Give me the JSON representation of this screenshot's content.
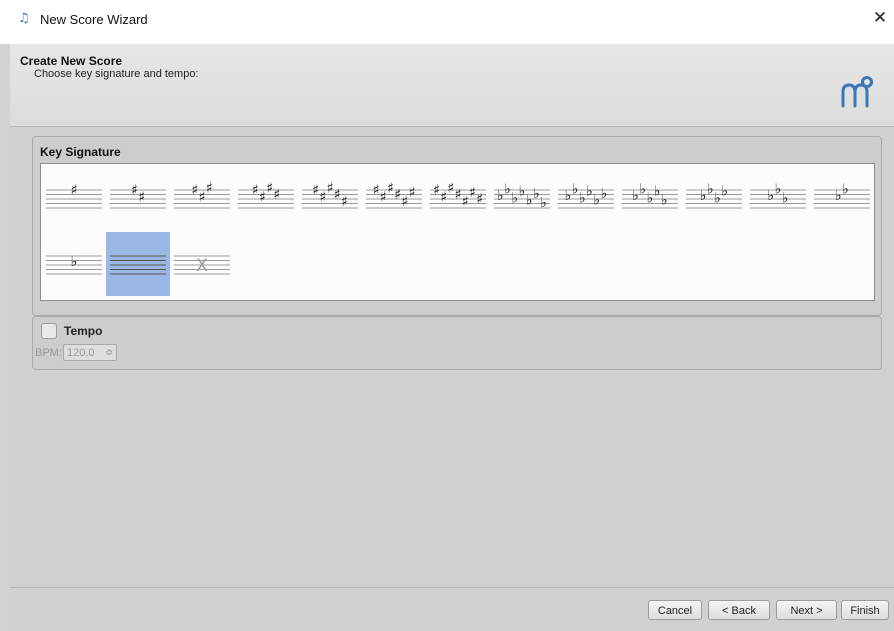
{
  "window": {
    "title": "New Score Wizard",
    "close_glyph": "✕",
    "app_icon_glyph": "♫"
  },
  "header": {
    "title": "Create New Score",
    "subtitle": "Choose key signature and tempo:",
    "logo_icon": "musescore-logo-icon"
  },
  "key_signature": {
    "title": "Key Signature",
    "selected": "none",
    "keys": [
      {
        "id": "sharps-1",
        "type": "sharp",
        "count": 1
      },
      {
        "id": "sharps-2",
        "type": "sharp",
        "count": 2
      },
      {
        "id": "sharps-3",
        "type": "sharp",
        "count": 3
      },
      {
        "id": "sharps-4",
        "type": "sharp",
        "count": 4
      },
      {
        "id": "sharps-5",
        "type": "sharp",
        "count": 5
      },
      {
        "id": "sharps-6",
        "type": "sharp",
        "count": 6
      },
      {
        "id": "sharps-7",
        "type": "sharp",
        "count": 7
      },
      {
        "id": "flats-7",
        "type": "flat",
        "count": 7
      },
      {
        "id": "flats-6",
        "type": "flat",
        "count": 6
      },
      {
        "id": "flats-5",
        "type": "flat",
        "count": 5
      },
      {
        "id": "flats-4",
        "type": "flat",
        "count": 4
      },
      {
        "id": "flats-3",
        "type": "flat",
        "count": 3
      },
      {
        "id": "flats-2",
        "type": "flat",
        "count": 2
      },
      {
        "id": "flats-1",
        "type": "flat",
        "count": 1
      },
      {
        "id": "none",
        "type": "none",
        "count": 0
      },
      {
        "id": "atonal",
        "type": "atonal",
        "count": 0
      }
    ]
  },
  "tempo": {
    "label": "Tempo",
    "checked": false,
    "bpm_label": "BPM:",
    "bpm_value": "120.0",
    "spin_arrows": "≎"
  },
  "buttons": {
    "cancel": "Cancel",
    "back": "< Back",
    "next": "Next >",
    "finish": "Finish"
  },
  "colors": {
    "selection": "#9ab7e6",
    "logo": "#3a76b8"
  }
}
